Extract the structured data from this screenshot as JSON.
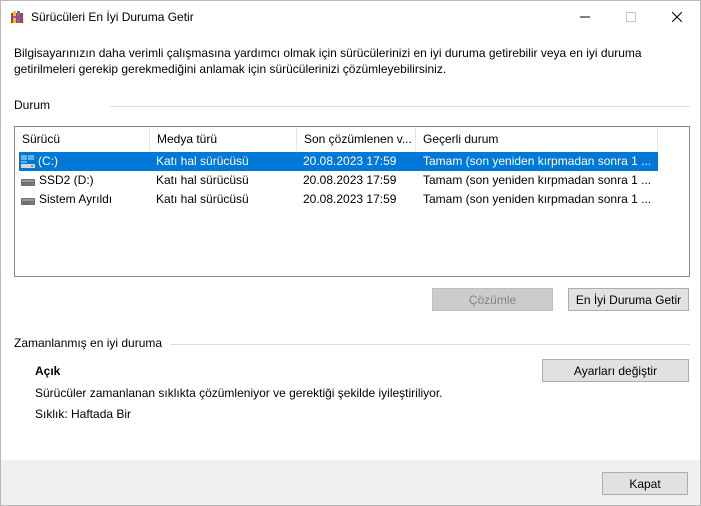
{
  "window": {
    "title": "Sürücüleri En İyi Duruma Getir",
    "icon": "defrag-app-icon"
  },
  "intro_text": "Bilgisayarınızın daha verimli çalışmasına yardımcı olmak için sürücülerinizi en iyi duruma getirebilir veya en iyi duruma getirilmeleri gerekip gerekmediğini anlamak için sürücülerinizi çözümleyebilirsiniz.",
  "status_section": {
    "label": "Durum",
    "columns": [
      "Sürücü",
      "Medya türü",
      "Son çözümlenen v...",
      "Geçerli durum"
    ],
    "rows": [
      {
        "drive": "(C:)",
        "media": "Katı hal sürücüsü",
        "last": "20.08.2023 17:59",
        "status": "Tamam (son yeniden kırpmadan sonra 1 ...",
        "icon": "windows-drive-icon",
        "selected": true
      },
      {
        "drive": "SSD2 (D:)",
        "media": "Katı hal sürücüsü",
        "last": "20.08.2023 17:59",
        "status": "Tamam (son yeniden kırpmadan sonra 1 ...",
        "icon": "drive-icon",
        "selected": false
      },
      {
        "drive": "Sistem Ayrıldı",
        "media": "Katı hal sürücüsü",
        "last": "20.08.2023 17:59",
        "status": "Tamam (son yeniden kırpmadan sonra 1 ...",
        "icon": "drive-icon",
        "selected": false
      }
    ],
    "analyze_button": "Çözümle",
    "optimize_button": "En İyi Duruma Getir"
  },
  "scheduled_section": {
    "label": "Zamanlanmış en iyi duruma",
    "state": "Açık",
    "description": "Sürücüler zamanlanan sıklıkta çözümleniyor ve gerektiği şekilde iyileştiriliyor.",
    "frequency": "Sıklık: Haftada Bir",
    "change_settings_button": "Ayarları değiştir"
  },
  "close_button": "Kapat",
  "colors": {
    "selection": "#0078d7",
    "footer": "#f0f0f0",
    "button": "#e1e1e1",
    "button_disabled": "#cccccc"
  }
}
